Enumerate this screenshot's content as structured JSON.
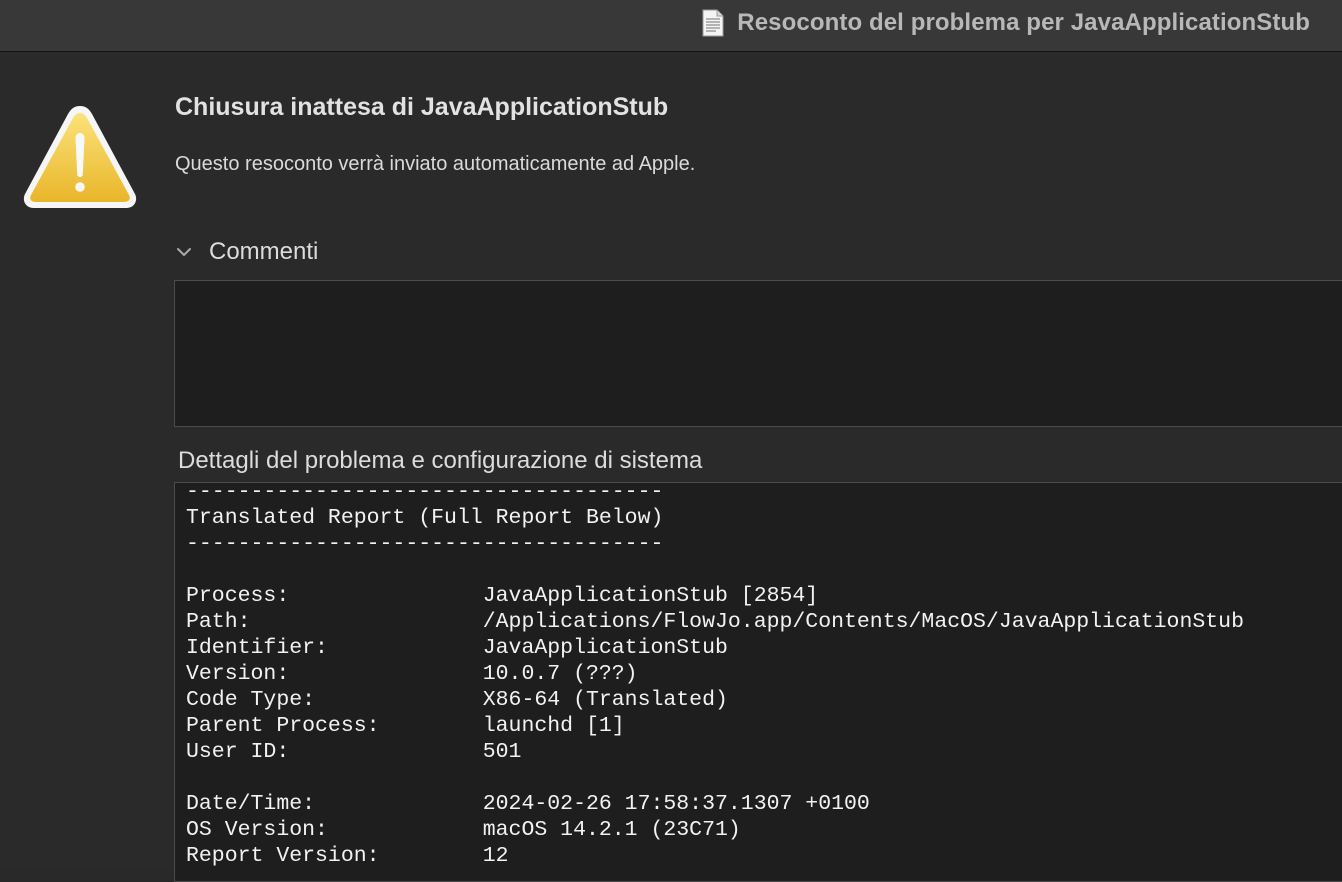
{
  "window": {
    "title": "Resoconto del problema per JavaApplicationStub",
    "title_icon": "document-icon"
  },
  "alert": {
    "icon": "warning-icon",
    "heading": "Chiusura inattesa di JavaApplicationStub",
    "message": "Questo resoconto verrà inviato automaticamente ad Apple."
  },
  "comments": {
    "label": "Commenti",
    "expanded": true,
    "value": ""
  },
  "details": {
    "label": "Dettagli del problema e configurazione di sistema",
    "lines": [
      "-------------------------------------",
      "Translated Report (Full Report Below)",
      "-------------------------------------",
      "",
      "Process:               JavaApplicationStub [2854]",
      "Path:                  /Applications/FlowJo.app/Contents/MacOS/JavaApplicationStub",
      "Identifier:            JavaApplicationStub",
      "Version:               10.0.7 (???)",
      "Code Type:             X86-64 (Translated)",
      "Parent Process:        launchd [1]",
      "User ID:               501",
      "",
      "Date/Time:             2024-02-26 17:58:37.1307 +0100",
      "OS Version:            macOS 14.2.1 (23C71)",
      "Report Version:        12"
    ]
  },
  "colors": {
    "titlebar": "#383838",
    "background": "#2a2a2a",
    "field_background": "#1e1e1e",
    "warning_yellow": "#f2c531"
  }
}
